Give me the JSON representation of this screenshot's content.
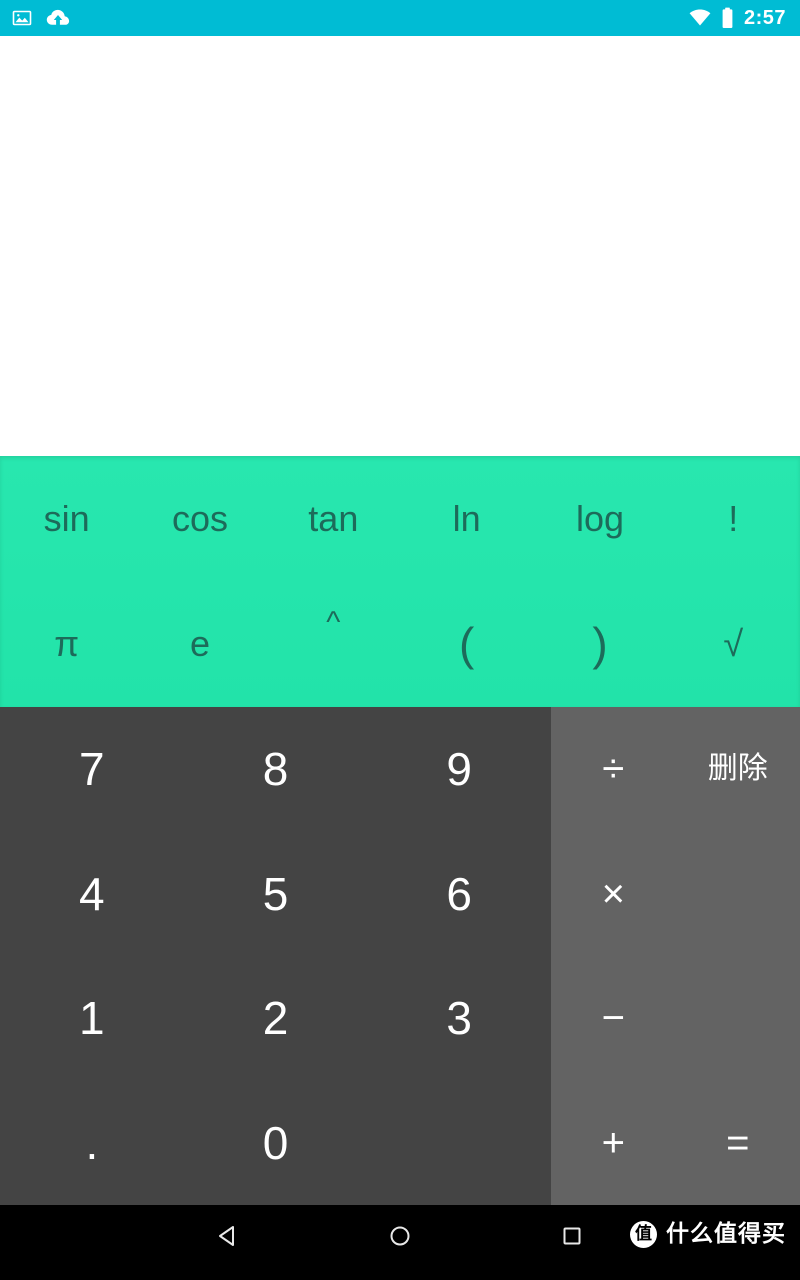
{
  "status_bar": {
    "background_color": "#00bcd4",
    "left_icons": [
      {
        "name": "screenshot-icon",
        "glyph": "image"
      },
      {
        "name": "cloud-upload-icon",
        "glyph": "cloud-up"
      }
    ],
    "right_icons": [
      {
        "name": "wifi-icon",
        "glyph": "wifi"
      },
      {
        "name": "battery-icon",
        "glyph": "battery-full"
      }
    ],
    "time": "2:57"
  },
  "display": {
    "background_color": "#ffffff",
    "formula": "",
    "result": ""
  },
  "advanced_pad": {
    "background_color": "#26e6ad",
    "text_color": "#1d6b5a",
    "rows": [
      [
        {
          "name": "sin-key",
          "label": "sin"
        },
        {
          "name": "cos-key",
          "label": "cos"
        },
        {
          "name": "tan-key",
          "label": "tan"
        },
        {
          "name": "ln-key",
          "label": "ln"
        },
        {
          "name": "log-key",
          "label": "log"
        },
        {
          "name": "factorial-key",
          "label": "!"
        }
      ],
      [
        {
          "name": "pi-key",
          "label": "π"
        },
        {
          "name": "e-key",
          "label": "e"
        },
        {
          "name": "power-key",
          "label": "^"
        },
        {
          "name": "left-paren-key",
          "label": "("
        },
        {
          "name": "right-paren-key",
          "label": ")"
        },
        {
          "name": "sqrt-key",
          "label": "√"
        }
      ]
    ]
  },
  "numpad": {
    "background_color": "#444444",
    "text_color": "#ffffff",
    "rows": [
      [
        {
          "name": "digit-7-key",
          "label": "7"
        },
        {
          "name": "digit-8-key",
          "label": "8"
        },
        {
          "name": "digit-9-key",
          "label": "9"
        }
      ],
      [
        {
          "name": "digit-4-key",
          "label": "4"
        },
        {
          "name": "digit-5-key",
          "label": "5"
        },
        {
          "name": "digit-6-key",
          "label": "6"
        }
      ],
      [
        {
          "name": "digit-1-key",
          "label": "1"
        },
        {
          "name": "digit-2-key",
          "label": "2"
        },
        {
          "name": "digit-3-key",
          "label": "3"
        }
      ],
      [
        {
          "name": "decimal-point-key",
          "label": "."
        },
        {
          "name": "digit-0-key",
          "label": "0"
        },
        {
          "name": "empty-key",
          "label": ""
        }
      ]
    ]
  },
  "operator_pad": {
    "background_color": "#636363",
    "text_color": "#ffffff",
    "rows": [
      [
        {
          "name": "divide-key",
          "label": "÷"
        },
        {
          "name": "delete-key",
          "label": "删除"
        }
      ],
      [
        {
          "name": "multiply-key",
          "label": "×"
        },
        {
          "name": "operator-empty-key",
          "label": ""
        }
      ],
      [
        {
          "name": "minus-key",
          "label": "−"
        },
        {
          "name": "operator-empty-key-2",
          "label": ""
        }
      ],
      [
        {
          "name": "plus-key",
          "label": "+"
        },
        {
          "name": "equals-key",
          "label": "="
        }
      ]
    ]
  },
  "nav_bar": {
    "background_color": "#000000",
    "buttons": [
      {
        "name": "back-button",
        "glyph": "triangle-left"
      },
      {
        "name": "home-button",
        "glyph": "circle"
      },
      {
        "name": "recents-button",
        "glyph": "square"
      }
    ],
    "watermark": {
      "badge": "值",
      "text": "什么值得买"
    }
  }
}
